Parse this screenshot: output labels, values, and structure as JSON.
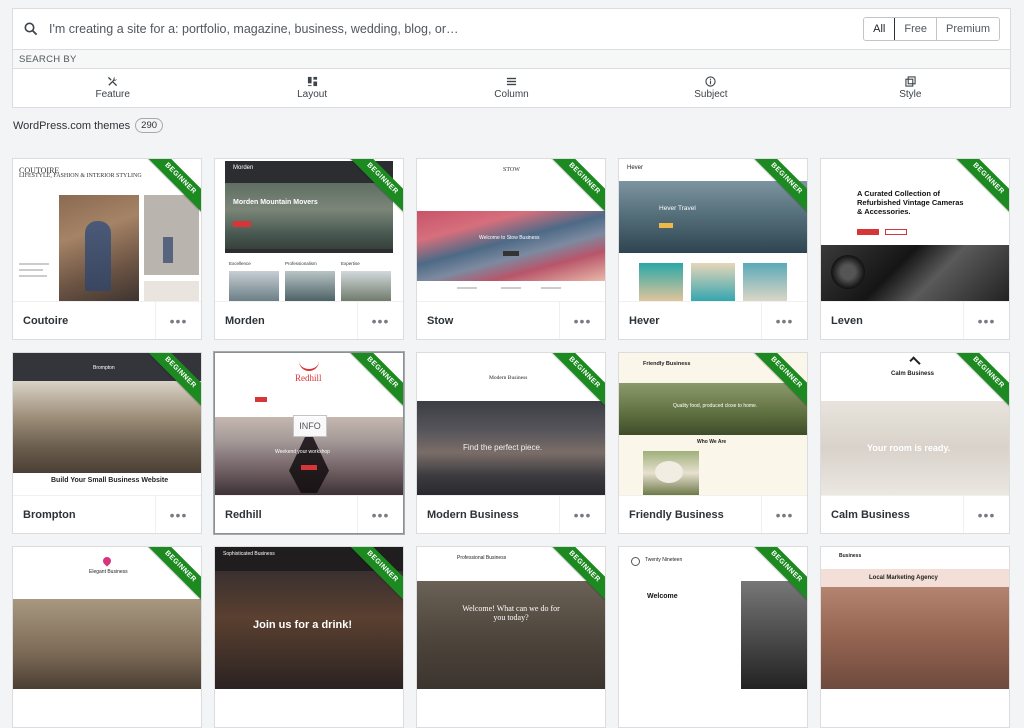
{
  "search": {
    "placeholder": "I'm creating a site for a: portfolio, magazine, business, wedding, blog, or…"
  },
  "tiers": [
    "All",
    "Free",
    "Premium"
  ],
  "search_by_label": "SEARCH BY",
  "filters": [
    {
      "label": "Feature",
      "icon": "tools-icon"
    },
    {
      "label": "Layout",
      "icon": "layout-icon"
    },
    {
      "label": "Column",
      "icon": "column-icon"
    },
    {
      "label": "Subject",
      "icon": "info-icon"
    },
    {
      "label": "Style",
      "icon": "style-icon"
    }
  ],
  "themes_header": {
    "label": "WordPress.com themes",
    "count": "290"
  },
  "ribbon_label": "BEGINNER",
  "info_label": "INFO",
  "more_label": "•••",
  "themes": [
    {
      "name": "Coutoire",
      "t1": "COUTOIRE",
      "t2": "LIFESTYLE, FASHION & INTERIOR STYLING"
    },
    {
      "name": "Morden",
      "t1": "Morden",
      "t2": "Morden Mountain Movers",
      "t3": "Excellence",
      "t4": "Professionalism",
      "t5": "Expertise"
    },
    {
      "name": "Stow",
      "t1": "STOW",
      "t2": "Welcome to Stow Business"
    },
    {
      "name": "Hever",
      "t1": "Hever",
      "t2": "Hever Travel"
    },
    {
      "name": "Leven",
      "t1": "A Curated Collection of Refurbished Vintage Cameras & Accessories."
    },
    {
      "name": "Brompton",
      "t1": "Brompton",
      "t2": "Build Your Small Business Website"
    },
    {
      "name": "Redhill",
      "t1": "Redhill",
      "t2": "Weekend your workshop"
    },
    {
      "name": "Modern Business",
      "t1": "Modern Business",
      "t2": "Find the perfect piece."
    },
    {
      "name": "Friendly Business",
      "t1": "Friendly Business",
      "t2": "Quality food, produced close to home.",
      "t3": "Who We Are"
    },
    {
      "name": "Calm Business",
      "t1": "Calm Business",
      "t2": "Your room is ready."
    },
    {
      "name": "Elegant Business",
      "t1": "Elegant Business"
    },
    {
      "name": "Sophisticated Business",
      "t1": "Sophisticated Business",
      "t2": "Join us for a drink!"
    },
    {
      "name": "Professional Business",
      "t1": "Professional Business",
      "t2": "Welcome! What can we do for you today?"
    },
    {
      "name": "Twenty Nineteen",
      "t1": "Twenty Nineteen",
      "t2": "Welcome"
    },
    {
      "name": "Business",
      "t1": "Business",
      "t2": "Local Marketing Agency"
    }
  ],
  "colors": {
    "ribbon": "#1d8a21",
    "accent": "#d63638"
  }
}
